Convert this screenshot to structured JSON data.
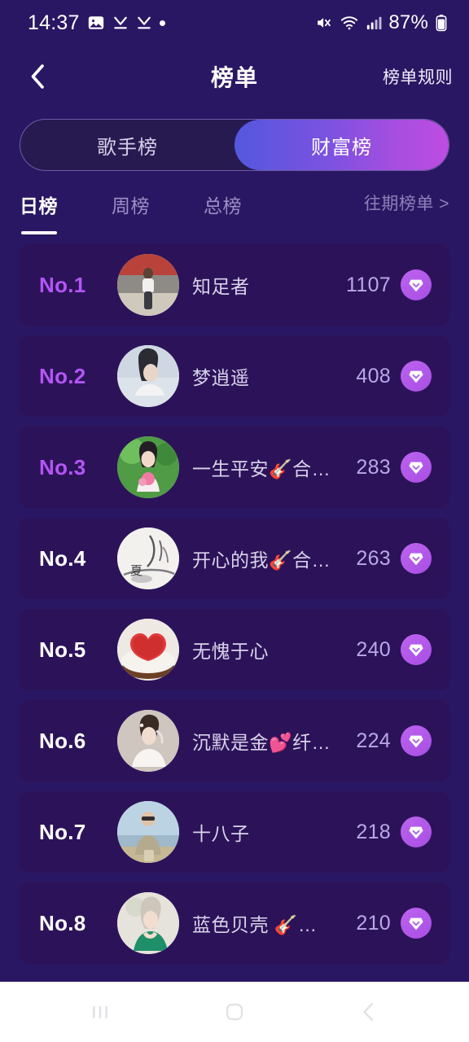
{
  "status_bar": {
    "time": "14:37",
    "battery_percent": "87%",
    "icons": [
      "photo-icon",
      "download-done-icon",
      "download-done-icon",
      "dot-indicator",
      "mute-icon",
      "wifi-icon",
      "cellular-signal-icon",
      "battery-icon"
    ]
  },
  "header": {
    "back_icon": "chevron-left-icon",
    "title": "榜单",
    "rules_label": "榜单规则"
  },
  "segmented": {
    "options": [
      {
        "label": "歌手榜",
        "active": false
      },
      {
        "label": "财富榜",
        "active": true
      }
    ],
    "active_gradient_start": "#5358de",
    "active_gradient_end": "#bf4ce2"
  },
  "tabs": {
    "items": [
      {
        "label": "日榜",
        "active": true
      },
      {
        "label": "周榜",
        "active": false
      },
      {
        "label": "总榜",
        "active": false
      }
    ],
    "history_label": "往期榜单 >"
  },
  "list": {
    "badge_icon": "gem-icon",
    "rows": [
      {
        "rank": "No.1",
        "name": "知足者",
        "score": "1107",
        "highlight": true,
        "avatar": "street-photo-avatar"
      },
      {
        "rank": "No.2",
        "name": "梦逍遥",
        "score": "408",
        "highlight": true,
        "avatar": "portrait-avatar"
      },
      {
        "rank": "No.3",
        "name": "一生平安🎸合…",
        "score": "283",
        "highlight": true,
        "avatar": "flower-girl-avatar"
      },
      {
        "rank": "No.4",
        "name": "开心的我🎸合…",
        "score": "263",
        "highlight": false,
        "avatar": "ink-painting-avatar"
      },
      {
        "rank": "No.5",
        "name": "无愧于心",
        "score": "240",
        "highlight": false,
        "avatar": "heart-cake-avatar"
      },
      {
        "rank": "No.6",
        "name": "沉默是金💕纤…",
        "score": "224",
        "highlight": false,
        "avatar": "bride-avatar"
      },
      {
        "rank": "No.7",
        "name": "十八子",
        "score": "218",
        "highlight": false,
        "avatar": "seaside-avatar"
      },
      {
        "rank": "No.8",
        "name": "蓝色贝壳 🎸…",
        "score": "210",
        "highlight": false,
        "avatar": "green-dress-avatar"
      }
    ]
  },
  "navbar": {
    "recents_icon": "recents-icon",
    "home_icon": "home-icon",
    "back_icon": "back-icon"
  },
  "colors": {
    "page_background": "#2a1763",
    "card_background": "#2c1359",
    "accent_purple": "#b455f5",
    "score_text": "#b9a9e6",
    "name_text": "#d9d3ea"
  }
}
